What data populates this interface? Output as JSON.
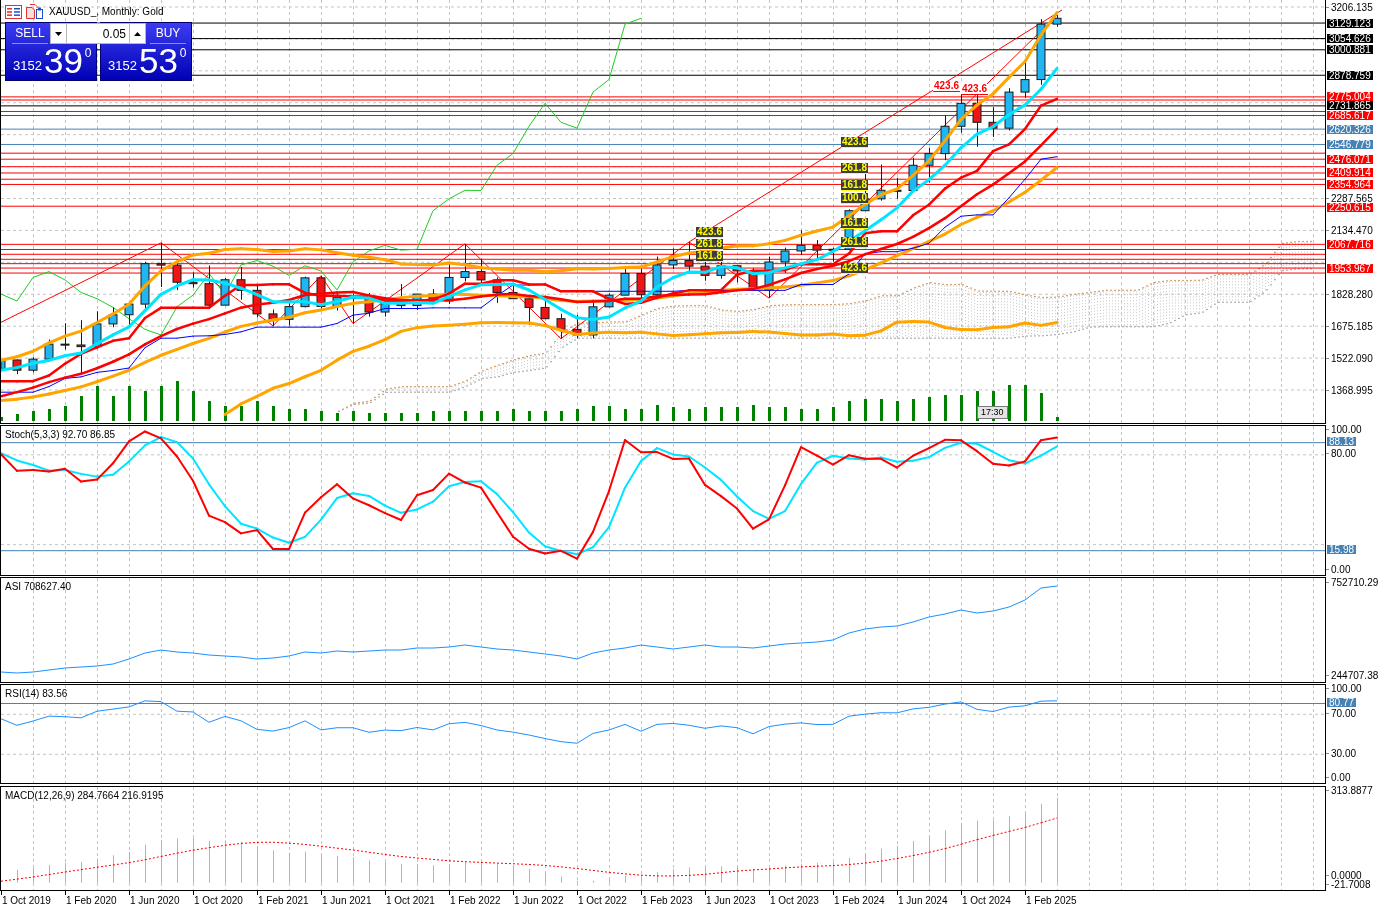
{
  "chart": {
    "title": "XAUUSD_, Monthly: Gold",
    "countdown": "17:30"
  },
  "trade_panel": {
    "sell": {
      "label": "SELL",
      "price_prefix": "3152",
      "price_main": "39",
      "price_sup": "0"
    },
    "volume": "0.05",
    "buy": {
      "label": "BUY",
      "price_prefix": "3152",
      "price_main": "53",
      "price_sup": "0"
    }
  },
  "fibonacci_groups": [
    {
      "color": "#ffff00",
      "levels": [
        "423.6",
        "261.8",
        "161.8"
      ]
    },
    {
      "color": "#ffff00",
      "levels": [
        "423.6",
        "261.8",
        "161.8",
        "100.0",
        "161.8",
        "261.8",
        "423.6"
      ]
    },
    {
      "color": "#ff0000",
      "levels": [
        "423.6",
        "423.6"
      ]
    }
  ],
  "price_axis": {
    "ticks": [
      "3206.135",
      "2287.565",
      "2134.470",
      "1828.280",
      "1675.185",
      "1522.090",
      "1368.995"
    ],
    "levels": [
      {
        "label": "3129.123",
        "color": "#000000"
      },
      {
        "label": "3054.626",
        "color": "#000000"
      },
      {
        "label": "3000.881",
        "color": "#000000"
      },
      {
        "label": "2878.759",
        "color": "#000000"
      },
      {
        "label": "2775.004",
        "color": "#ff0000"
      },
      {
        "label": "2731.865",
        "color": "#000000"
      },
      {
        "label": "2685.617",
        "color": "#ff0000"
      },
      {
        "label": "2620.326",
        "color": "#4682b4"
      },
      {
        "label": "2546.779",
        "color": "#4682b4"
      },
      {
        "label": "2476.071",
        "color": "#ff0000"
      },
      {
        "label": "2409.914",
        "color": "#ff0000"
      },
      {
        "label": "2354.964",
        "color": "#ff0000"
      },
      {
        "label": "2250.615",
        "color": "#ff0000"
      },
      {
        "label": "2067.716",
        "color": "#ff0000"
      },
      {
        "label": "1953.967",
        "color": "#ff0000"
      }
    ]
  },
  "indicators": [
    {
      "kind": "stochastic",
      "title": "Stoch(5,3,3) 92.70 86.85",
      "scale": [
        "100.00",
        "80.00",
        "0.00"
      ],
      "levels": [
        "88.13",
        "15.98"
      ]
    },
    {
      "kind": "asi",
      "title": "ASI 708627.40",
      "scale": [
        "752710.29",
        "244707.38"
      ]
    },
    {
      "kind": "rsi",
      "title": "RSI(14) 83.56",
      "scale": [
        "100.00",
        "70.00",
        "30.00",
        "0.00"
      ],
      "levels": [
        "80.77"
      ]
    },
    {
      "kind": "macd",
      "title": "MACD(12,26,9) 284.7664 216.9195",
      "scale": [
        "313.8877",
        "0.0000",
        "-21.7008"
      ]
    }
  ],
  "time_axis": [
    "1 Oct 2019",
    "1 Feb 2020",
    "1 Jun 2020",
    "1 Oct 2020",
    "1 Feb 2021",
    "1 Jun 2021",
    "1 Oct 2021",
    "1 Feb 2022",
    "1 Jun 2022",
    "1 Oct 2022",
    "1 Feb 2023",
    "1 Jun 2023",
    "1 Oct 2023",
    "1 Feb 2024",
    "1 Jun 2024",
    "1 Oct 2024",
    "1 Feb 2025"
  ]
}
